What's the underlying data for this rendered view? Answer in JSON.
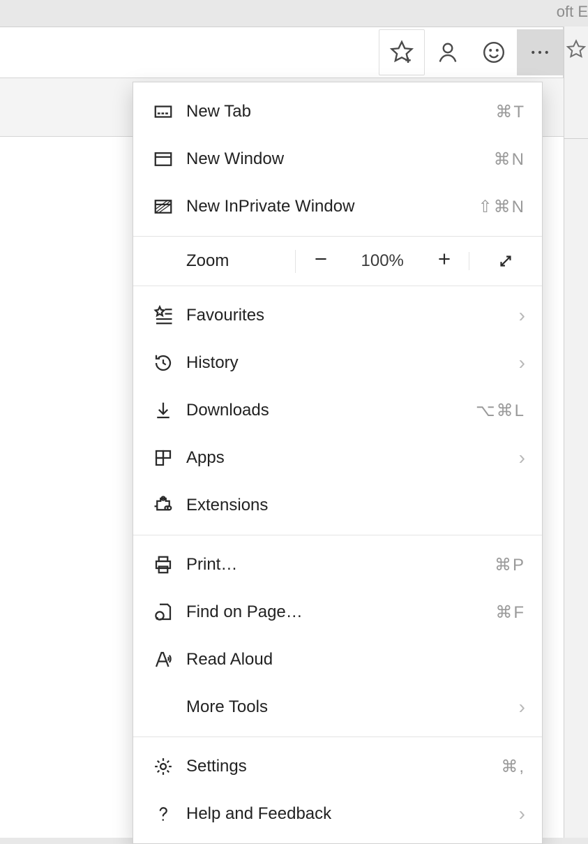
{
  "titlebar_fragment": "oft E",
  "toolbar": {
    "icons": {
      "star_add": "star-add-icon",
      "profile": "profile-icon",
      "smile": "smile-icon",
      "more": "more-icon"
    }
  },
  "menu": {
    "new_tab": {
      "label": "New Tab",
      "shortcut": "⌘T"
    },
    "new_window": {
      "label": "New Window",
      "shortcut": "⌘N"
    },
    "new_inprivate": {
      "label": "New InPrivate Window",
      "shortcut": "⇧⌘N"
    },
    "zoom": {
      "label": "Zoom",
      "value": "100%"
    },
    "favourites": {
      "label": "Favourites"
    },
    "history": {
      "label": "History"
    },
    "downloads": {
      "label": "Downloads",
      "shortcut": "⌥⌘L"
    },
    "apps": {
      "label": "Apps"
    },
    "extensions": {
      "label": "Extensions"
    },
    "print": {
      "label": "Print…",
      "shortcut": "⌘P"
    },
    "find_on_page": {
      "label": "Find on Page…",
      "shortcut": "⌘F"
    },
    "read_aloud": {
      "label": "Read Aloud"
    },
    "more_tools": {
      "label": "More Tools"
    },
    "settings": {
      "label": "Settings",
      "shortcut": "⌘,"
    },
    "help": {
      "label": "Help and Feedback"
    }
  }
}
